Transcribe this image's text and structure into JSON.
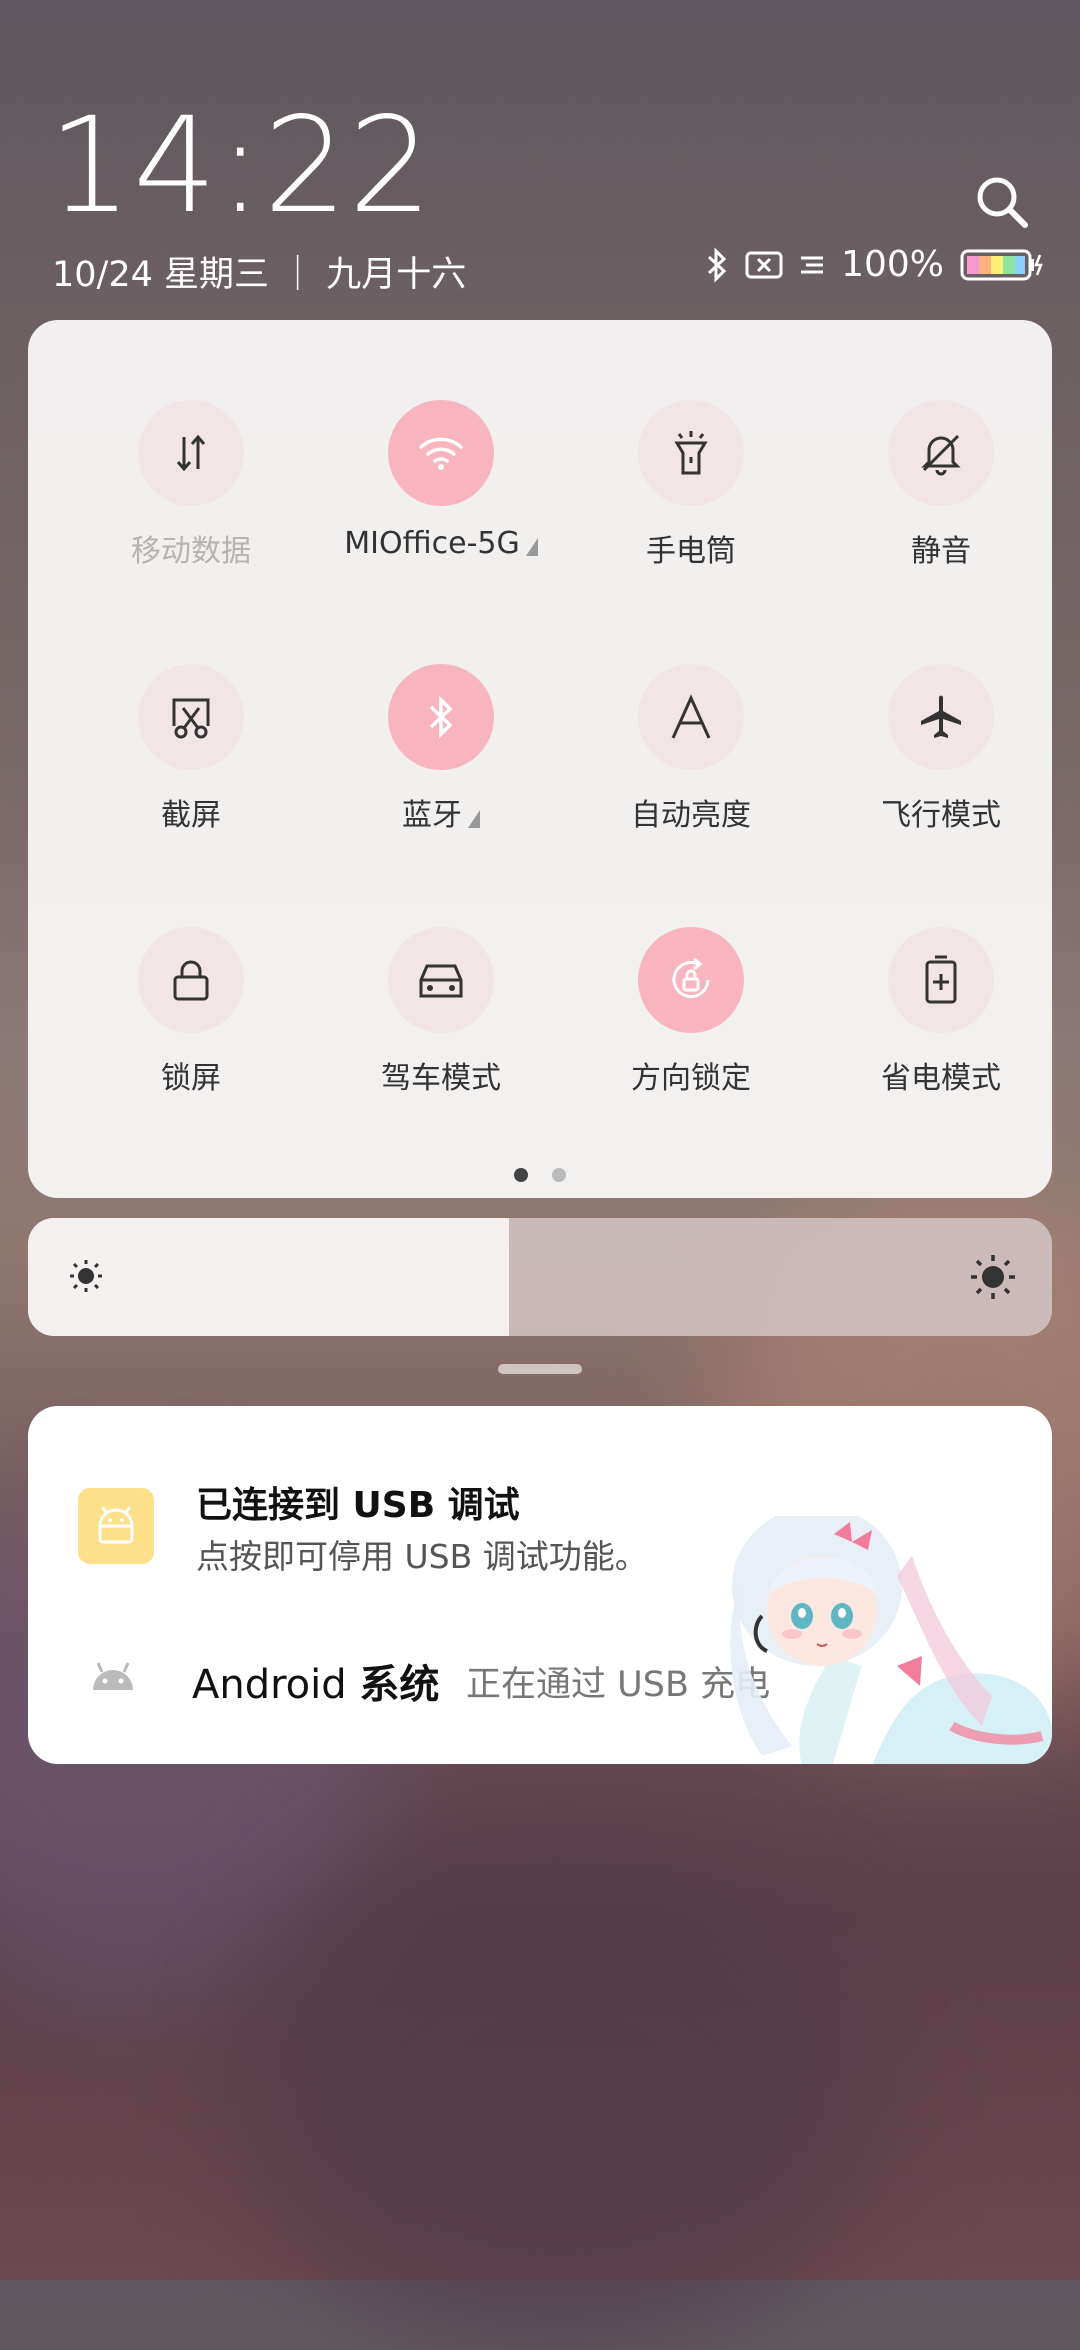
{
  "clock": {
    "time": "14:22",
    "date": "10/24  星期三 ｜ 九月十六"
  },
  "status": {
    "battery": "100%"
  },
  "tiles": [
    {
      "label": "移动数据",
      "icon": "mobile-data-icon",
      "on": false
    },
    {
      "label": "MIOffice-5G",
      "icon": "wifi-icon",
      "on": true
    },
    {
      "label": "手电筒",
      "icon": "flashlight-icon",
      "on": false
    },
    {
      "label": "静音",
      "icon": "mute-icon",
      "on": false
    },
    {
      "label": "截屏",
      "icon": "screenshot-icon",
      "on": false
    },
    {
      "label": "蓝牙",
      "icon": "bluetooth-icon",
      "on": true
    },
    {
      "label": "自动亮度",
      "icon": "auto-brightness-icon",
      "on": false
    },
    {
      "label": "飞行模式",
      "icon": "airplane-icon",
      "on": false
    },
    {
      "label": "锁屏",
      "icon": "lock-icon",
      "on": false
    },
    {
      "label": "驾车模式",
      "icon": "car-icon",
      "on": false
    },
    {
      "label": "方向锁定",
      "icon": "rotation-lock-icon",
      "on": true
    },
    {
      "label": "省电模式",
      "icon": "battery-saver-icon",
      "on": false
    }
  ],
  "pager": {
    "pages": 2,
    "current": 1
  },
  "brightness": {
    "level": 0.47
  },
  "notifications": [
    {
      "title": "已连接到 USB 调试",
      "body": "点按即可停用 USB 调试功能。"
    },
    {
      "app": "Android",
      "app_suffix": "系统",
      "text": "正在通过 USB 充电"
    }
  ]
}
